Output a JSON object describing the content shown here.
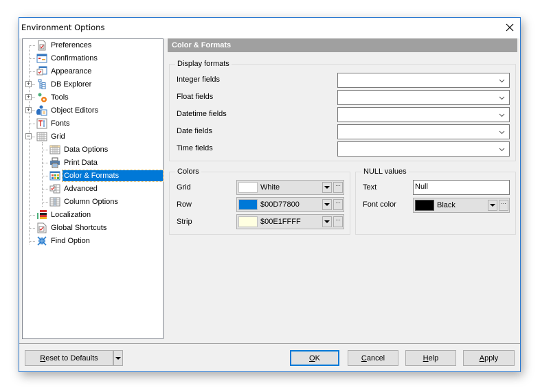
{
  "window": {
    "title": "Environment Options",
    "close_icon": "close-icon"
  },
  "tree": {
    "items": [
      {
        "label": "Preferences",
        "icon": "preferences-icon",
        "level": 0,
        "expander": null
      },
      {
        "label": "Confirmations",
        "icon": "confirmations-icon",
        "level": 0,
        "expander": null
      },
      {
        "label": "Appearance",
        "icon": "appearance-icon",
        "level": 0,
        "expander": null
      },
      {
        "label": "DB Explorer",
        "icon": "db-explorer-icon",
        "level": 0,
        "expander": "+"
      },
      {
        "label": "Tools",
        "icon": "tools-gear-icon",
        "level": 0,
        "expander": "+"
      },
      {
        "label": "Object Editors",
        "icon": "object-editors-icon",
        "level": 0,
        "expander": "+"
      },
      {
        "label": "Fonts",
        "icon": "fonts-icon",
        "level": 0,
        "expander": null
      },
      {
        "label": "Grid",
        "icon": "grid-icon",
        "level": 0,
        "expander": "-"
      },
      {
        "label": "Data Options",
        "icon": "data-options-icon",
        "level": 1,
        "expander": null
      },
      {
        "label": "Print Data",
        "icon": "printer-icon",
        "level": 1,
        "expander": null
      },
      {
        "label": "Color & Formats",
        "icon": "color-formats-icon",
        "level": 1,
        "expander": null,
        "selected": true
      },
      {
        "label": "Advanced",
        "icon": "advanced-icon",
        "level": 1,
        "expander": null
      },
      {
        "label": "Column Options",
        "icon": "column-options-icon",
        "level": 1,
        "expander": null
      },
      {
        "label": "Localization",
        "icon": "localization-icon",
        "level": 0,
        "expander": null
      },
      {
        "label": "Global Shortcuts",
        "icon": "global-shortcuts-icon",
        "level": 0,
        "expander": null
      },
      {
        "label": "Find Option",
        "icon": "find-option-icon",
        "level": 0,
        "expander": null
      }
    ]
  },
  "panel": {
    "header": "Color & Formats",
    "display_formats": {
      "title": "Display formats",
      "fields": [
        {
          "label": "Integer fields",
          "value": ""
        },
        {
          "label": "Float fields",
          "value": ""
        },
        {
          "label": "Datetime fields",
          "value": ""
        },
        {
          "label": "Date fields",
          "value": ""
        },
        {
          "label": "Time fields",
          "value": ""
        }
      ]
    },
    "colors": {
      "title": "Colors",
      "rows": [
        {
          "label": "Grid",
          "value": "White",
          "swatch": "#ffffff"
        },
        {
          "label": "Row",
          "value": "$00D77800",
          "swatch": "#0078d7"
        },
        {
          "label": "Strip",
          "value": "$00E1FFFF",
          "swatch": "#ffffe1"
        }
      ],
      "more_label": "···"
    },
    "null_values": {
      "title": "NULL values",
      "text_label": "Text",
      "text_value": "Null",
      "font_color_label": "Font color",
      "font_color_value": "Black",
      "font_color_swatch": "#000000",
      "more_label": "···"
    }
  },
  "footer": {
    "reset_label": "Reset to Defaults",
    "reset_mnemonic": "R",
    "reset_rest": "eset to Defaults",
    "ok": {
      "mnemonic": "O",
      "rest": "K"
    },
    "cancel": {
      "mnemonic": "C",
      "rest": "ancel"
    },
    "help": {
      "mnemonic": "H",
      "rest": "elp"
    },
    "apply": {
      "mnemonic": "A",
      "rest": "pply"
    }
  }
}
